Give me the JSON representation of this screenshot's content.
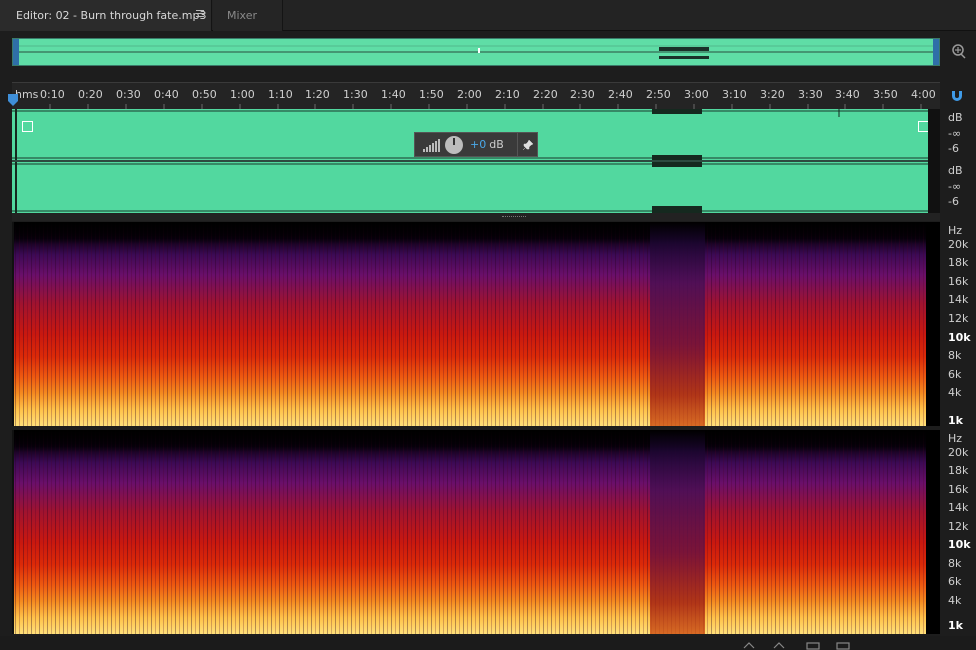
{
  "tabs": {
    "editor_label": "Editor: 02 - Burn through fate.mp3",
    "mixer_label": "Mixer"
  },
  "ruler": {
    "unit_label": "hms",
    "labels": [
      "0:10",
      "0:20",
      "0:30",
      "0:40",
      "0:50",
      "1:00",
      "1:10",
      "1:20",
      "1:30",
      "1:40",
      "1:50",
      "2:00",
      "2:10",
      "2:20",
      "2:30",
      "2:40",
      "2:50",
      "3:00",
      "3:10",
      "3:20",
      "3:30",
      "3:40",
      "3:50",
      "4:00"
    ]
  },
  "hud": {
    "value": "+0",
    "unit": "dB"
  },
  "db_scale": {
    "ch1": [
      "dB",
      "-∞",
      "-6"
    ],
    "ch2": [
      "dB",
      "-∞",
      "-6"
    ]
  },
  "hz_scale": {
    "ch1": [
      "Hz",
      "20k",
      "18k",
      "16k",
      "14k",
      "12k",
      "10k",
      "8k",
      "6k",
      "4k",
      "1k"
    ],
    "ch2": [
      "Hz",
      "20k",
      "18k",
      "16k",
      "14k",
      "12k",
      "10k",
      "8k",
      "6k",
      "4k",
      "1k"
    ]
  },
  "colors": {
    "waveform": "#52d89f",
    "accent": "#4aa8e8",
    "selection_handle": "#2f6fa8"
  },
  "icons": {
    "menu": "hamburger-menu-icon",
    "zoom": "zoom-icon",
    "snap": "magnet-snap-icon",
    "pin": "pin-icon",
    "playhead": "playhead-marker-icon"
  }
}
